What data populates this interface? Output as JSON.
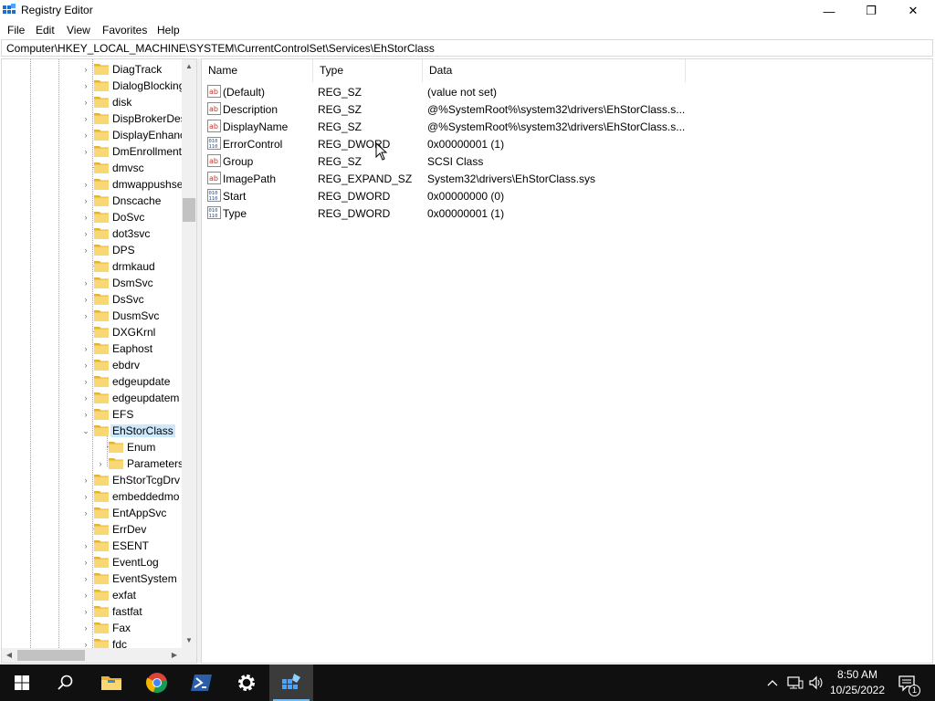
{
  "window": {
    "title": "Registry Editor",
    "buttons": {
      "minimize": "—",
      "maximize": "❐",
      "close": "✕"
    }
  },
  "menu": [
    "File",
    "Edit",
    "View",
    "Favorites",
    "Help"
  ],
  "address": "Computer\\HKEY_LOCAL_MACHINE\\SYSTEM\\CurrentControlSet\\Services\\EhStorClass",
  "tree": {
    "items": [
      {
        "label": "DiagTrack",
        "expander": "›"
      },
      {
        "label": "DialogBlocking",
        "expander": "›"
      },
      {
        "label": "disk",
        "expander": "›"
      },
      {
        "label": "DispBrokerDes",
        "expander": "›"
      },
      {
        "label": "DisplayEnhanc",
        "expander": "›"
      },
      {
        "label": "DmEnrollment",
        "expander": "›"
      },
      {
        "label": "dmvsc",
        "expander": ""
      },
      {
        "label": "dmwappushse",
        "expander": "›"
      },
      {
        "label": "Dnscache",
        "expander": "›"
      },
      {
        "label": "DoSvc",
        "expander": "›"
      },
      {
        "label": "dot3svc",
        "expander": "›"
      },
      {
        "label": "DPS",
        "expander": "›"
      },
      {
        "label": "drmkaud",
        "expander": ""
      },
      {
        "label": "DsmSvc",
        "expander": "›"
      },
      {
        "label": "DsSvc",
        "expander": "›"
      },
      {
        "label": "DusmSvc",
        "expander": "›"
      },
      {
        "label": "DXGKrnl",
        "expander": ""
      },
      {
        "label": "Eaphost",
        "expander": "›"
      },
      {
        "label": "ebdrv",
        "expander": "›"
      },
      {
        "label": "edgeupdate",
        "expander": "›"
      },
      {
        "label": "edgeupdatem",
        "expander": "›"
      },
      {
        "label": "EFS",
        "expander": "›"
      },
      {
        "label": "EhStorClass",
        "expander": "⌄",
        "selected": true
      },
      {
        "label": "Enum",
        "expander": "",
        "child": true
      },
      {
        "label": "Parameters",
        "expander": "›",
        "child": true
      },
      {
        "label": "EhStorTcgDrv",
        "expander": "›"
      },
      {
        "label": "embeddedmo",
        "expander": "›"
      },
      {
        "label": "EntAppSvc",
        "expander": "›"
      },
      {
        "label": "ErrDev",
        "expander": ""
      },
      {
        "label": "ESENT",
        "expander": "›"
      },
      {
        "label": "EventLog",
        "expander": "›"
      },
      {
        "label": "EventSystem",
        "expander": "›"
      },
      {
        "label": "exfat",
        "expander": "›"
      },
      {
        "label": "fastfat",
        "expander": "›"
      },
      {
        "label": "Fax",
        "expander": "›"
      },
      {
        "label": "fdc",
        "expander": "›"
      }
    ],
    "scroll_up": "▲",
    "scroll_down": "▼",
    "scroll_left": "◀",
    "scroll_right": "▶"
  },
  "values": {
    "headers": {
      "name": "Name",
      "type": "Type",
      "data": "Data"
    },
    "rows": [
      {
        "icon": "string-value-icon",
        "name": "(Default)",
        "type": "REG_SZ",
        "data": "(value not set)"
      },
      {
        "icon": "string-value-icon",
        "name": "Description",
        "type": "REG_SZ",
        "data": "@%SystemRoot%\\system32\\drivers\\EhStorClass.s..."
      },
      {
        "icon": "string-value-icon",
        "name": "DisplayName",
        "type": "REG_SZ",
        "data": "@%SystemRoot%\\system32\\drivers\\EhStorClass.s..."
      },
      {
        "icon": "binary-value-icon",
        "name": "ErrorControl",
        "type": "REG_DWORD",
        "data": "0x00000001 (1)"
      },
      {
        "icon": "string-value-icon",
        "name": "Group",
        "type": "REG_SZ",
        "data": "SCSI Class"
      },
      {
        "icon": "string-value-icon",
        "name": "ImagePath",
        "type": "REG_EXPAND_SZ",
        "data": "System32\\drivers\\EhStorClass.sys"
      },
      {
        "icon": "binary-value-icon",
        "name": "Start",
        "type": "REG_DWORD",
        "data": "0x00000000 (0)"
      },
      {
        "icon": "binary-value-icon",
        "name": "Type",
        "type": "REG_DWORD",
        "data": "0x00000001 (1)"
      }
    ]
  },
  "taskbar": {
    "apps": [
      "start-icon",
      "search-icon",
      "file-explorer-icon",
      "chrome-icon",
      "powershell-icon",
      "settings-icon",
      "registry-editor-icon"
    ],
    "active": "registry-editor-icon",
    "clock": {
      "time": "8:50 AM",
      "date": "10/25/2022"
    },
    "notification_count": "1",
    "colors": {
      "taskbar_bg": "#101010",
      "selection": "#cce8ff",
      "folder": "#f8d775"
    }
  }
}
